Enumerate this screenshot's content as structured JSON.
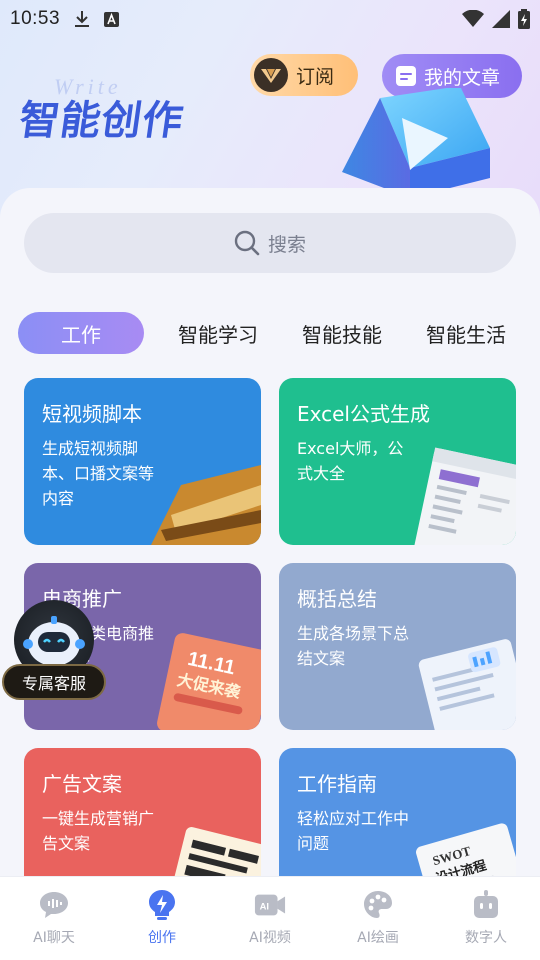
{
  "status_bar": {
    "time": "10:53"
  },
  "hero": {
    "title": "智能创作",
    "subscribe_label": "订阅",
    "my_articles_label": "我的文章"
  },
  "search": {
    "placeholder": "搜索"
  },
  "tabs": [
    {
      "label": "工作",
      "active": true
    },
    {
      "label": "智能学习",
      "active": false
    },
    {
      "label": "智能技能",
      "active": false
    },
    {
      "label": "智能生活",
      "active": false
    }
  ],
  "cards": [
    {
      "title": "短视频脚本",
      "desc": "生成短视频脚本、口播文案等内容",
      "color": "#2f8bdf"
    },
    {
      "title": "Excel公式生成",
      "desc": "Excel大师，公式大全",
      "color": "#1fbf8f"
    },
    {
      "title": "电商推广",
      "desc": "生成各类电商推广内容",
      "color": "#7a66aa"
    },
    {
      "title": "概括总结",
      "desc": "生成各场景下总结文案",
      "color": "#92a9cf"
    },
    {
      "title": "广告文案",
      "desc": "一键生成营销广告文案",
      "color": "#e9625e"
    },
    {
      "title": "工作指南",
      "desc": "轻松应对工作中问题",
      "color": "#5594e4"
    }
  ],
  "card_art_text": {
    "sale_big": "11.11",
    "sale_sub": "大促来袭",
    "swot": "SWOT",
    "swot_sub": "设计流程"
  },
  "assistant": {
    "label": "专属客服"
  },
  "bottom_nav": [
    {
      "label": "AI聊天",
      "icon": "chat-bubble-icon",
      "active": false
    },
    {
      "label": "创作",
      "icon": "lightning-icon",
      "active": true
    },
    {
      "label": "AI视频",
      "icon": "video-camera-icon",
      "active": false
    },
    {
      "label": "AI绘画",
      "icon": "palette-icon",
      "active": false
    },
    {
      "label": "数字人",
      "icon": "robot-icon",
      "active": false
    }
  ]
}
